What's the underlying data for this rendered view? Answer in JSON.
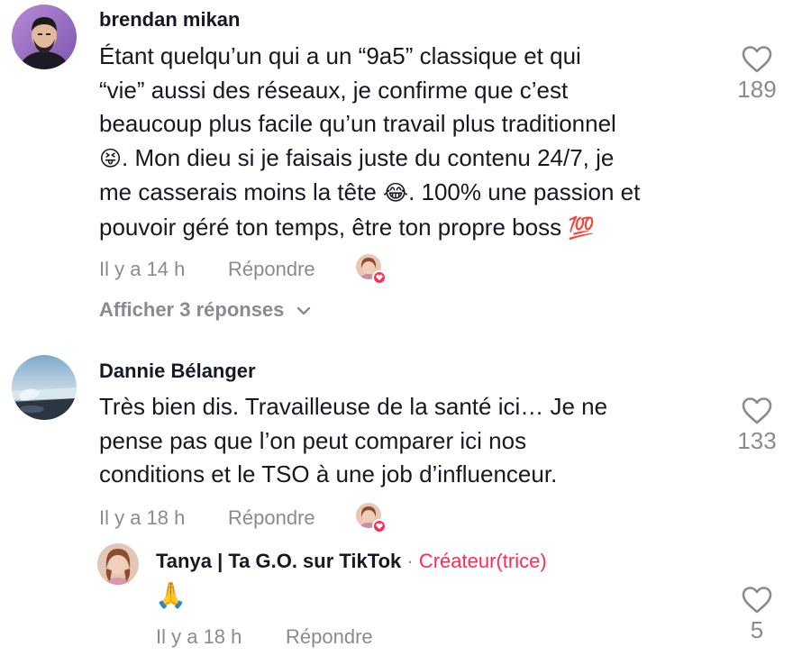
{
  "comments": [
    {
      "username": "brendan mikan",
      "text_lines": [
        "Étant quelqu’un qui a un “9a5” classique et qui",
        "“vie” aussi des réseaux, je confirme que c’est",
        "beaucoup plus facile qu’un travail plus traditionnel",
        ". Mon dieu si je faisais juste du contenu 24/7, je",
        "me casserais moins la tête . 100% une passion et",
        "pouvoir géré ton temps, être ton propre boss"
      ],
      "emoji_1": "😝",
      "emoji_2": "😂",
      "emoji_3": "💯",
      "time": "Il y a 14 h",
      "reply_label": "Répondre",
      "like_count": "189",
      "view_replies": "Afficher 3 réponses"
    },
    {
      "username": "Dannie Bélanger",
      "text_lines": [
        "Très bien dis. Travailleuse de la santé ici… Je ne",
        "pense pas que l’on peut comparer ici nos",
        "conditions et le TSO à une job d’influenceur."
      ],
      "time": "Il y a 18 h",
      "reply_label": "Répondre",
      "like_count": "133"
    }
  ],
  "reply": {
    "username": "Tanya | Ta G.O. sur TikTok",
    "separator": "·",
    "creator_tag": "Créateur(trice)",
    "text": "🙏",
    "time": "Il y a 18 h",
    "reply_label": "Répondre",
    "like_count": "5"
  },
  "colors": {
    "text": "#161823",
    "muted": "#8a8b91",
    "accent": "#fe2c55"
  },
  "icons": {
    "like": "heart-outline-icon",
    "chevron": "chevron-down-icon",
    "creator_liked": "heart-badge-icon"
  }
}
